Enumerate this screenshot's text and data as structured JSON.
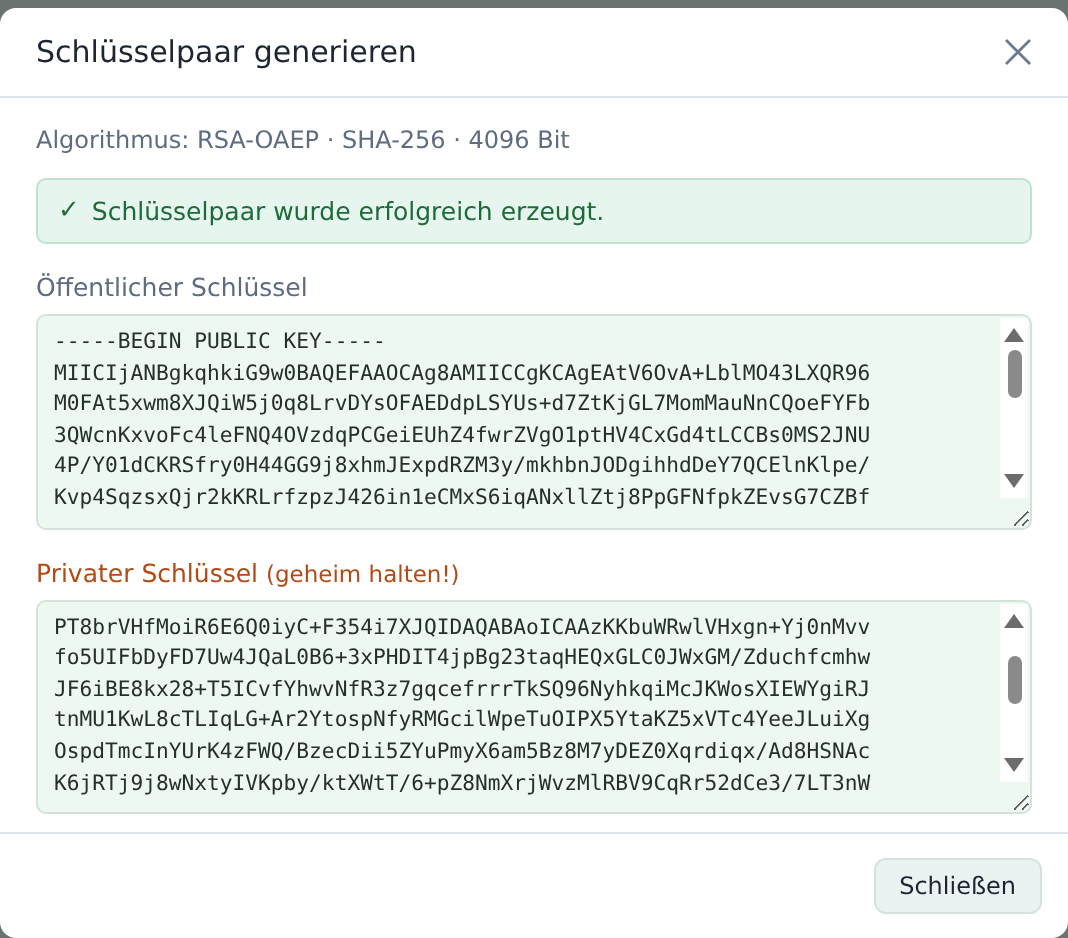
{
  "dialog": {
    "title": "Schlüsselpaar generieren"
  },
  "algorithm": "Algorithmus: RSA-OAEP · SHA-256 · 4096 Bit",
  "alert": {
    "kind": "success",
    "icon": "✓",
    "message": "Schlüsselpaar wurde erfolgreich erzeugt."
  },
  "keys": [
    {
      "kind": "public",
      "label": "Öffentlicher Schlüssel",
      "lines": [
        "-----BEGIN PUBLIC KEY-----",
        "MIICIjANBgkqhkiG9w0BAQEFAAOCAg8AMIICCgKCAgEAtV6OvA+LblMO43LXQR96",
        "M0FAt5xwm8XJQiW5j0q8LrvDYsOFAEDdpLSYUs+d7ZtKjGL7MomMauNnCQoeFYFb",
        "3QWcnKxvoFc4leFNQ4OVzdqPCGeiEUhZ4fwrZVgO1ptHV4CxGd4tLCCBs0MS2JNU",
        "4P/Y01dCKRSfry0H44GG9j8xhmJExpdRZM3y/mkhbnJODgihhdDeY7QCElnKlpe/",
        "Kvp4SqzsxQjr2kKRLrfzpzJ426in1eCMxS6iqANxllZtj8PpGFNfpkZEvsG7CZBf"
      ]
    },
    {
      "kind": "private",
      "label": "Privater Schlüssel",
      "note": "(geheim halten!)",
      "lines": [
        "PT8brVHfMoiR6E6Q0iyC+F354i7XJQIDAQABAoICAAzKKbuWRwlVHxgn+Yj0nMvv",
        "fo5UIFbDyFD7Uw4JQaL0B6+3xPHDIT4jpBg23taqHEQxGLC0JWxGM/Zduchfcmhw",
        "JF6iBE8kx28+T5ICvfYhwvNfR3z7gqcefrrrTkSQ96NyhkqiMcJKWosXIEWYgiRJ",
        "tnMU1KwL8cTLIqLG+Ar2YtospNfyRMGcilWpeTuOIPX5YtaKZ5xVTc4YeeJLuiXg",
        "OspdTmcInYUrK4zFWQ/BzecDii5ZYuPmyX6am5Bz8M7yDEZ0Xqrdiqx/Ad8HSNAc",
        "K6jRTj9j8wNxtyIVKpby/ktXWtT/6+pZ8NmXrjWvzMlRBV9CqRr52dCe3/7LT3nW"
      ]
    }
  ],
  "buttons": [
    "Schließen"
  ]
}
